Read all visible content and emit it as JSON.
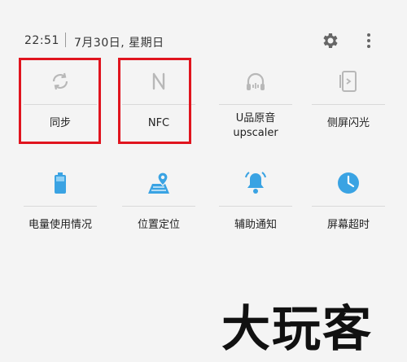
{
  "status": {
    "time": "22:51",
    "date": "7月30日, 星期日",
    "settings_icon": "gear-icon",
    "more_icon": "more-vertical-icon"
  },
  "tiles_row1": [
    {
      "label": "同步",
      "icon": "sync-icon",
      "highlighted": true
    },
    {
      "label": "NFC",
      "icon": "nfc-icon",
      "highlighted": true
    },
    {
      "label_line1": "U品原音",
      "label_line2": "upscaler",
      "icon": "headphones-icon",
      "highlighted": false
    },
    {
      "label": "侧屏闪光",
      "icon": "edge-lighting-icon",
      "highlighted": false
    }
  ],
  "tiles_row2": [
    {
      "label": "电量使用情况",
      "icon": "battery-icon",
      "color": "#3aa3e3"
    },
    {
      "label": "位置定位",
      "icon": "location-map-icon",
      "color": "#3aa3e3"
    },
    {
      "label": "辅助通知",
      "icon": "bell-icon",
      "color": "#3aa3e3"
    },
    {
      "label": "屏幕超时",
      "icon": "clock-icon",
      "color": "#3aa3e3"
    }
  ],
  "watermark": "大玩客",
  "colors": {
    "highlight_border": "#e0141e",
    "inactive_icon": "#b8b8b8",
    "active_icon": "#3aa3e3"
  }
}
